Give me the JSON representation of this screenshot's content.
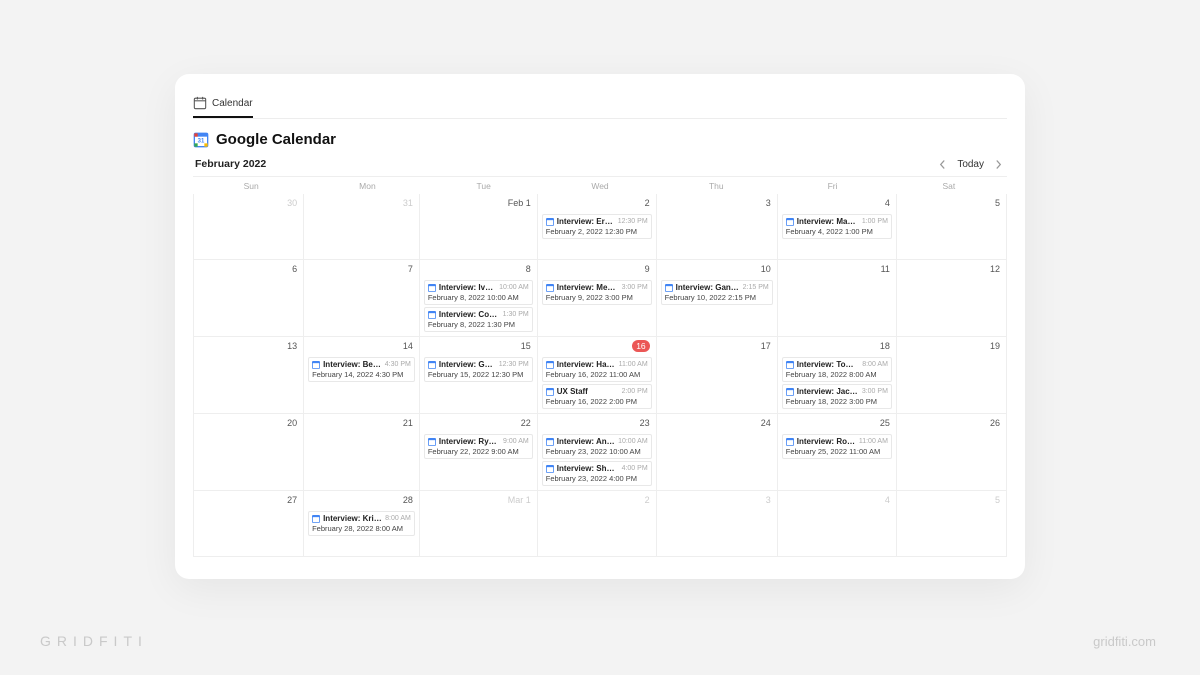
{
  "tab": {
    "label": "Calendar"
  },
  "header": {
    "title": "Google Calendar"
  },
  "subheader": {
    "month": "February 2022",
    "today": "Today"
  },
  "day_names": [
    "Sun",
    "Mon",
    "Tue",
    "Wed",
    "Thu",
    "Fri",
    "Sat"
  ],
  "days": [
    {
      "num": "30",
      "out": true
    },
    {
      "num": "31",
      "out": true
    },
    {
      "num": "Feb 1"
    },
    {
      "num": "2",
      "events": [
        {
          "title": "Interview: Eric S...",
          "time": "12:30 PM",
          "sub": "February 2, 2022 12:30 PM"
        }
      ]
    },
    {
      "num": "3"
    },
    {
      "num": "4",
      "events": [
        {
          "title": "Interview: Mandy ...",
          "time": "1:00 PM",
          "sub": "February 4, 2022 1:00 PM"
        }
      ]
    },
    {
      "num": "5"
    },
    {
      "num": "6"
    },
    {
      "num": "7"
    },
    {
      "num": "8",
      "events": [
        {
          "title": "Interview: Ivan Z",
          "time": "10:00 AM",
          "sub": "February 8, 2022 10:00 AM"
        },
        {
          "title": "Interview: Cory Etz",
          "time": "1:30 PM",
          "sub": "February 8, 2022 1:30 PM"
        }
      ]
    },
    {
      "num": "9",
      "events": [
        {
          "title": "Interview: Megan ...",
          "time": "3:00 PM",
          "sub": "February 9, 2022 3:00 PM"
        }
      ]
    },
    {
      "num": "10",
      "events": [
        {
          "title": "Interview: Ganesh S",
          "time": "2:15 PM",
          "sub": "February 10, 2022 2:15 PM"
        }
      ]
    },
    {
      "num": "11"
    },
    {
      "num": "12"
    },
    {
      "num": "13"
    },
    {
      "num": "14",
      "events": [
        {
          "title": "Interview: Becca C",
          "time": "4:30 PM",
          "sub": "February 14, 2022 4:30 PM"
        }
      ]
    },
    {
      "num": "15",
      "events": [
        {
          "title": "Interview: Galen P",
          "time": "12:30 PM",
          "sub": "February 15, 2022 12:30 PM"
        }
      ]
    },
    {
      "num": "16",
      "today": true,
      "events": [
        {
          "title": "Interview: Hanna...",
          "time": "11:00 AM",
          "sub": "February 16, 2022 11:00 AM"
        },
        {
          "title": "UX Staff",
          "time": "2:00 PM",
          "sub": "February 16, 2022 2:00 PM"
        }
      ]
    },
    {
      "num": "17"
    },
    {
      "num": "18",
      "events": [
        {
          "title": "Interview: Tommy L",
          "time": "8:00 AM",
          "sub": "February 18, 2022 8:00 AM"
        },
        {
          "title": "Interview: Jackie B",
          "time": "3:00 PM",
          "sub": "February 18, 2022 3:00 PM"
        }
      ]
    },
    {
      "num": "19"
    },
    {
      "num": "20"
    },
    {
      "num": "21"
    },
    {
      "num": "22",
      "events": [
        {
          "title": "Interview: Ryan H",
          "time": "9:00 AM",
          "sub": "February 22, 2022 9:00 AM"
        }
      ]
    },
    {
      "num": "23",
      "events": [
        {
          "title": "Interview: Angeli...",
          "time": "10:00 AM",
          "sub": "February 23, 2022 10:00 AM"
        },
        {
          "title": "Interview: Shalini L",
          "time": "4:00 PM",
          "sub": "February 23, 2022 4:00 PM"
        }
      ]
    },
    {
      "num": "24"
    },
    {
      "num": "25",
      "events": [
        {
          "title": "Interview: Rob S",
          "time": "11:00 AM",
          "sub": "February 25, 2022 11:00 AM"
        }
      ]
    },
    {
      "num": "26"
    },
    {
      "num": "27"
    },
    {
      "num": "28",
      "events": [
        {
          "title": "Interview: Kris C",
          "time": "8:00 AM",
          "sub": "February 28, 2022 8:00 AM"
        }
      ]
    },
    {
      "num": "Mar 1",
      "out": true
    },
    {
      "num": "2",
      "out": true
    },
    {
      "num": "3",
      "out": true
    },
    {
      "num": "4",
      "out": true
    },
    {
      "num": "5",
      "out": true
    }
  ],
  "watermark": {
    "left": "GRIDFITI",
    "right": "gridfiti.com"
  }
}
